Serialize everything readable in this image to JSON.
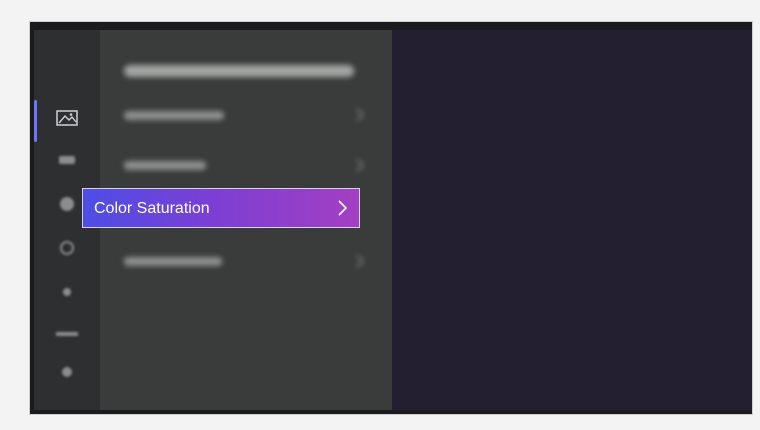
{
  "settings_menu": {
    "selected_item": {
      "label": "Color Saturation",
      "chevron_icon": "chevron-right-icon"
    }
  },
  "rail": {
    "icons": [
      "picture-icon",
      "sound-icon",
      "network-icon",
      "display-icon",
      "accessibility-icon",
      "system-icon",
      "support-icon"
    ]
  },
  "colors": {
    "selection_gradient_start": "#4d4ee6",
    "selection_gradient_end": "#a43fc2",
    "rail_indicator": "#6f74ff",
    "preview_background": "#231f30"
  }
}
